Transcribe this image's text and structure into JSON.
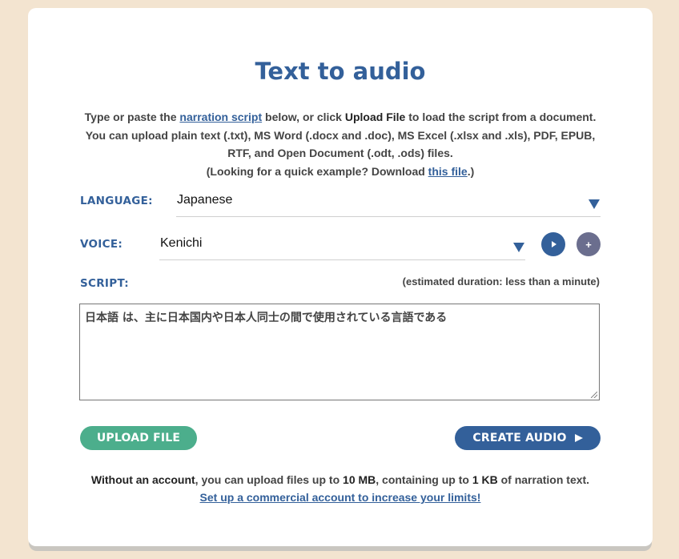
{
  "title": "Text to audio",
  "intro": {
    "p1": "Type or paste the ",
    "link1": "narration script",
    "p2": " below, or click ",
    "strong1": "Upload File",
    "p3": " to load the script from a document. You can upload plain text (.txt), MS Word (.docx and .doc), MS Excel (.xlsx and .xls), PDF, EPUB, RTF, and Open Document (.odt, .ods) files.",
    "p4": "(Looking for a quick example? Download ",
    "link2": "this file",
    "p5": ".)"
  },
  "language": {
    "label": "LANGUAGE:",
    "value": "Japanese"
  },
  "voice": {
    "label": "VOICE:",
    "value": "Kenichi"
  },
  "script": {
    "label": "SCRIPT:",
    "duration": "(estimated duration: less than a minute)",
    "text": "日本語 は、主に日本国内や日本人同士の間で使用されている言語である"
  },
  "buttons": {
    "upload": "UPLOAD FILE",
    "create": "CREATE AUDIO"
  },
  "limits": {
    "strong1": "Without an account",
    "t1": ", you can upload files up to ",
    "strong2": "10 MB",
    "t2": ", containing up to ",
    "strong3": "1 KB",
    "t3": " of narration text.",
    "link": "Set up a commercial account to increase your limits!"
  },
  "icons": {
    "voice_play": "play-icon",
    "voice_add": "plus-icon",
    "create_arrow": "play-arrow-icon"
  },
  "colors": {
    "accent": "#33609a",
    "upload": "#4cae8c",
    "background": "#f3e4d0"
  }
}
